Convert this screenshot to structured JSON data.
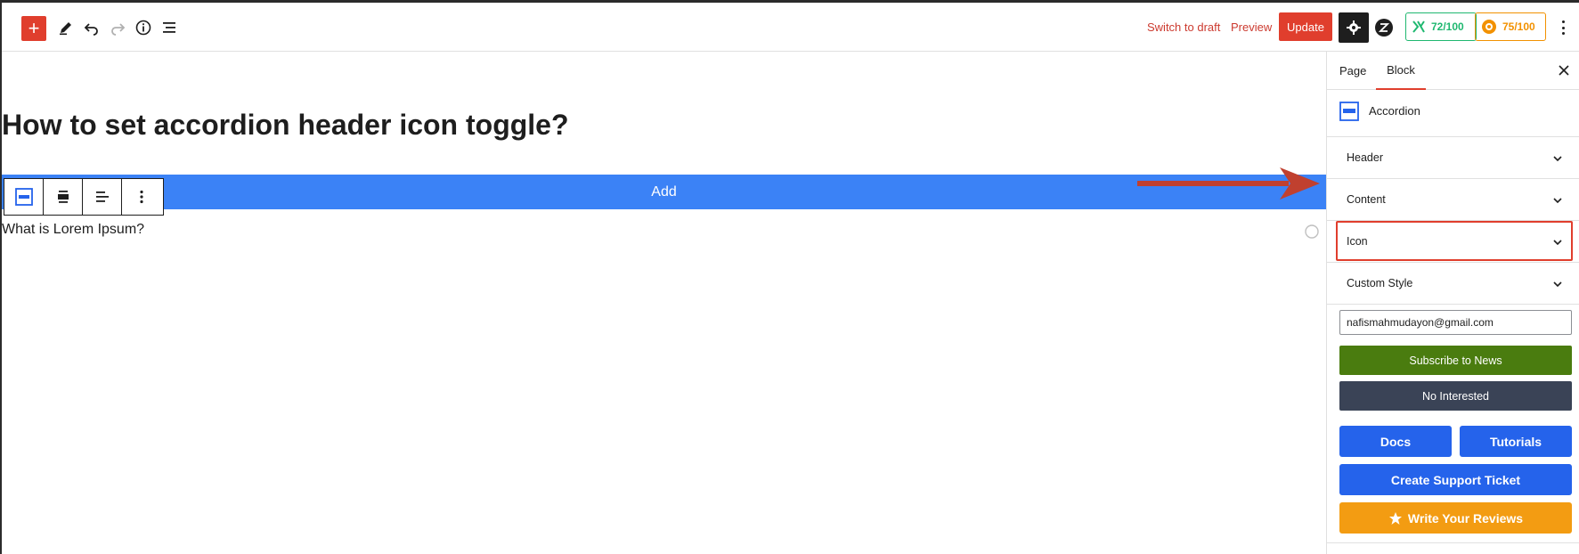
{
  "topbar": {
    "switch_to_draft": "Switch to draft",
    "preview": "Preview",
    "update": "Update",
    "score_green": "72/100",
    "score_orange": "75/100",
    "accent": "#e03e2d"
  },
  "canvas": {
    "title": "How to set accordion header icon toggle?",
    "add_bar_label": "Add",
    "accordion_item": "What is Lorem Ipsum?"
  },
  "sidebar": {
    "tabs": [
      {
        "label": "Page"
      },
      {
        "label": "Block"
      }
    ],
    "block_name": "Accordion",
    "panels": [
      {
        "label": "Header"
      },
      {
        "label": "Content"
      },
      {
        "label": "Icon"
      },
      {
        "label": "Custom Style"
      }
    ],
    "email_value": "nafismahmudayon@gmail.com",
    "subscribe_label": "Subscribe to News",
    "not_interested_label": "No Interested",
    "docs_label": "Docs",
    "tutorials_label": "Tutorials",
    "support_label": "Create Support Ticket",
    "reviews_label": "Write Your Reviews"
  }
}
